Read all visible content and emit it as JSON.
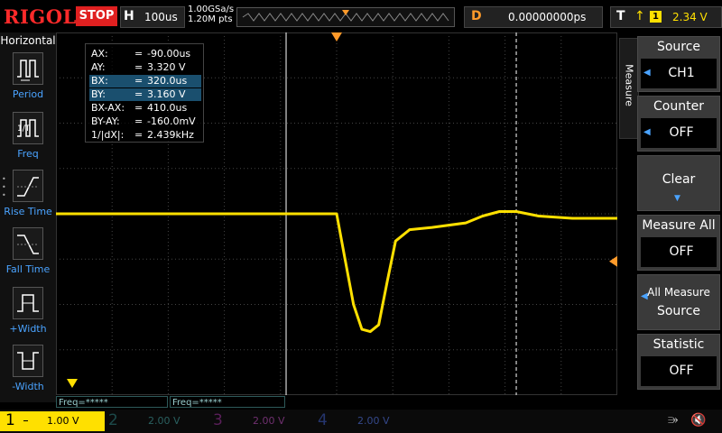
{
  "header": {
    "logo": "RIGOL",
    "run_state": "STOP",
    "timebase_label": "H",
    "timebase_value": "100us",
    "sample_rate": "1.00GSa/s",
    "memory_depth": "1.20M pts",
    "delay_label": "D",
    "delay_value": "0.00000000ps",
    "trigger_label": "T",
    "trigger_source": "1",
    "trigger_level": "2.34 V"
  },
  "horizontal_menu": {
    "title": "Horizontal",
    "items": [
      {
        "label": "Period",
        "icon": "period-icon"
      },
      {
        "label": "Freq",
        "icon": "freq-icon"
      },
      {
        "label": "Rise Time",
        "icon": "rise-time-icon"
      },
      {
        "label": "Fall Time",
        "icon": "fall-time-icon"
      },
      {
        "label": "+Width",
        "icon": "pos-width-icon"
      },
      {
        "label": "-Width",
        "icon": "neg-width-icon"
      }
    ]
  },
  "cursor_readout": [
    {
      "key": "AX:",
      "eq": "=",
      "value": "-90.00us",
      "highlight": false
    },
    {
      "key": "AY:",
      "eq": "=",
      "value": "3.320 V",
      "highlight": false
    },
    {
      "key": "BX:",
      "eq": "=",
      "value": "320.0us",
      "highlight": true
    },
    {
      "key": "BY:",
      "eq": "=",
      "value": "3.160 V",
      "highlight": true
    },
    {
      "key": "BX-AX:",
      "eq": "=",
      "value": "410.0us",
      "highlight": false
    },
    {
      "key": "BY-AY:",
      "eq": "=",
      "value": "-160.0mV",
      "highlight": false
    },
    {
      "key": "1/|dX|:",
      "eq": "=",
      "value": "2.439kHz",
      "highlight": false
    }
  ],
  "measure_menu": {
    "tab_label": "Measure",
    "source_title": "Source",
    "source_value": "CH1",
    "counter_title": "Counter",
    "counter_value": "OFF",
    "clear_label": "Clear",
    "measure_all_title": "Measure All",
    "measure_all_value": "OFF",
    "all_measure_source_line1": "All Measure",
    "all_measure_source_line2": "Source",
    "statistic_title": "Statistic",
    "statistic_value": "OFF"
  },
  "freq_readouts": [
    "Freq=*****",
    "Freq=*****"
  ],
  "channels": [
    {
      "num": "1",
      "scale": "1.00 V",
      "color": "#ffe000",
      "active": true
    },
    {
      "num": "2",
      "scale": "2.00 V",
      "color": "#00c8c8",
      "active": false
    },
    {
      "num": "3",
      "scale": "2.00 V",
      "color": "#e040e0",
      "active": false
    },
    {
      "num": "4",
      "scale": "2.00 V",
      "color": "#4a7dff",
      "active": false
    }
  ],
  "colors": {
    "trace": "#ffe000",
    "marker": "#ff9a2a",
    "accent": "#4aa3ff",
    "stop": "#e02020"
  },
  "waveform": {
    "x_range_us": [
      -500,
      500
    ],
    "y_range_v": [
      -4,
      4
    ],
    "baseline_v": 0.0,
    "points_us_v": [
      [
        -500,
        0
      ],
      [
        -5,
        0
      ],
      [
        0,
        0
      ],
      [
        15,
        -1.0
      ],
      [
        30,
        -2.0
      ],
      [
        45,
        -2.55
      ],
      [
        60,
        -2.6
      ],
      [
        75,
        -2.45
      ],
      [
        90,
        -1.5
      ],
      [
        105,
        -0.6
      ],
      [
        130,
        -0.35
      ],
      [
        170,
        -0.3
      ],
      [
        230,
        -0.2
      ],
      [
        260,
        -0.05
      ],
      [
        290,
        0.05
      ],
      [
        320,
        0.05
      ],
      [
        360,
        -0.05
      ],
      [
        420,
        -0.1
      ],
      [
        500,
        -0.1
      ]
    ]
  }
}
